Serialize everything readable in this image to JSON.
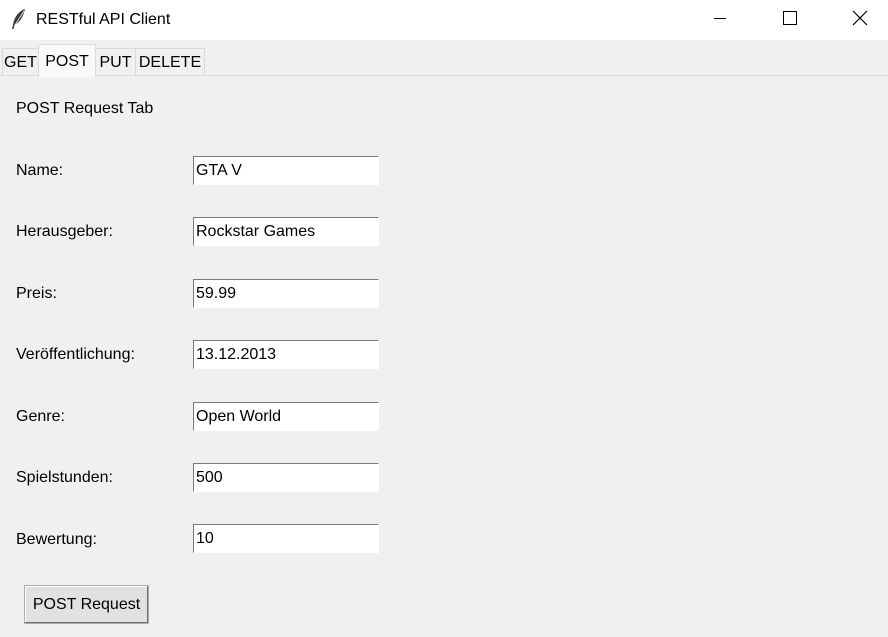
{
  "window": {
    "title": "RESTful API Client",
    "icon": "feather-icon",
    "controls": [
      "minimize-icon",
      "maximize-icon",
      "close-icon"
    ]
  },
  "tabs": [
    {
      "label": "GET",
      "active": false
    },
    {
      "label": "POST",
      "active": true
    },
    {
      "label": "PUT",
      "active": false
    },
    {
      "label": "DELETE",
      "active": false
    }
  ],
  "post_tab": {
    "heading": "POST Request Tab",
    "fields": [
      {
        "label": "Name:",
        "value": "GTA V"
      },
      {
        "label": "Herausgeber:",
        "value": "Rockstar Games"
      },
      {
        "label": "Preis:",
        "value": "59.99"
      },
      {
        "label": "Veröffentlichung:",
        "value": "13.12.2013"
      },
      {
        "label": "Genre:",
        "value": "Open World"
      },
      {
        "label": "Spielstunden:",
        "value": "500"
      },
      {
        "label": "Bewertung:",
        "value": "10"
      }
    ],
    "submit_label": "POST Request"
  }
}
